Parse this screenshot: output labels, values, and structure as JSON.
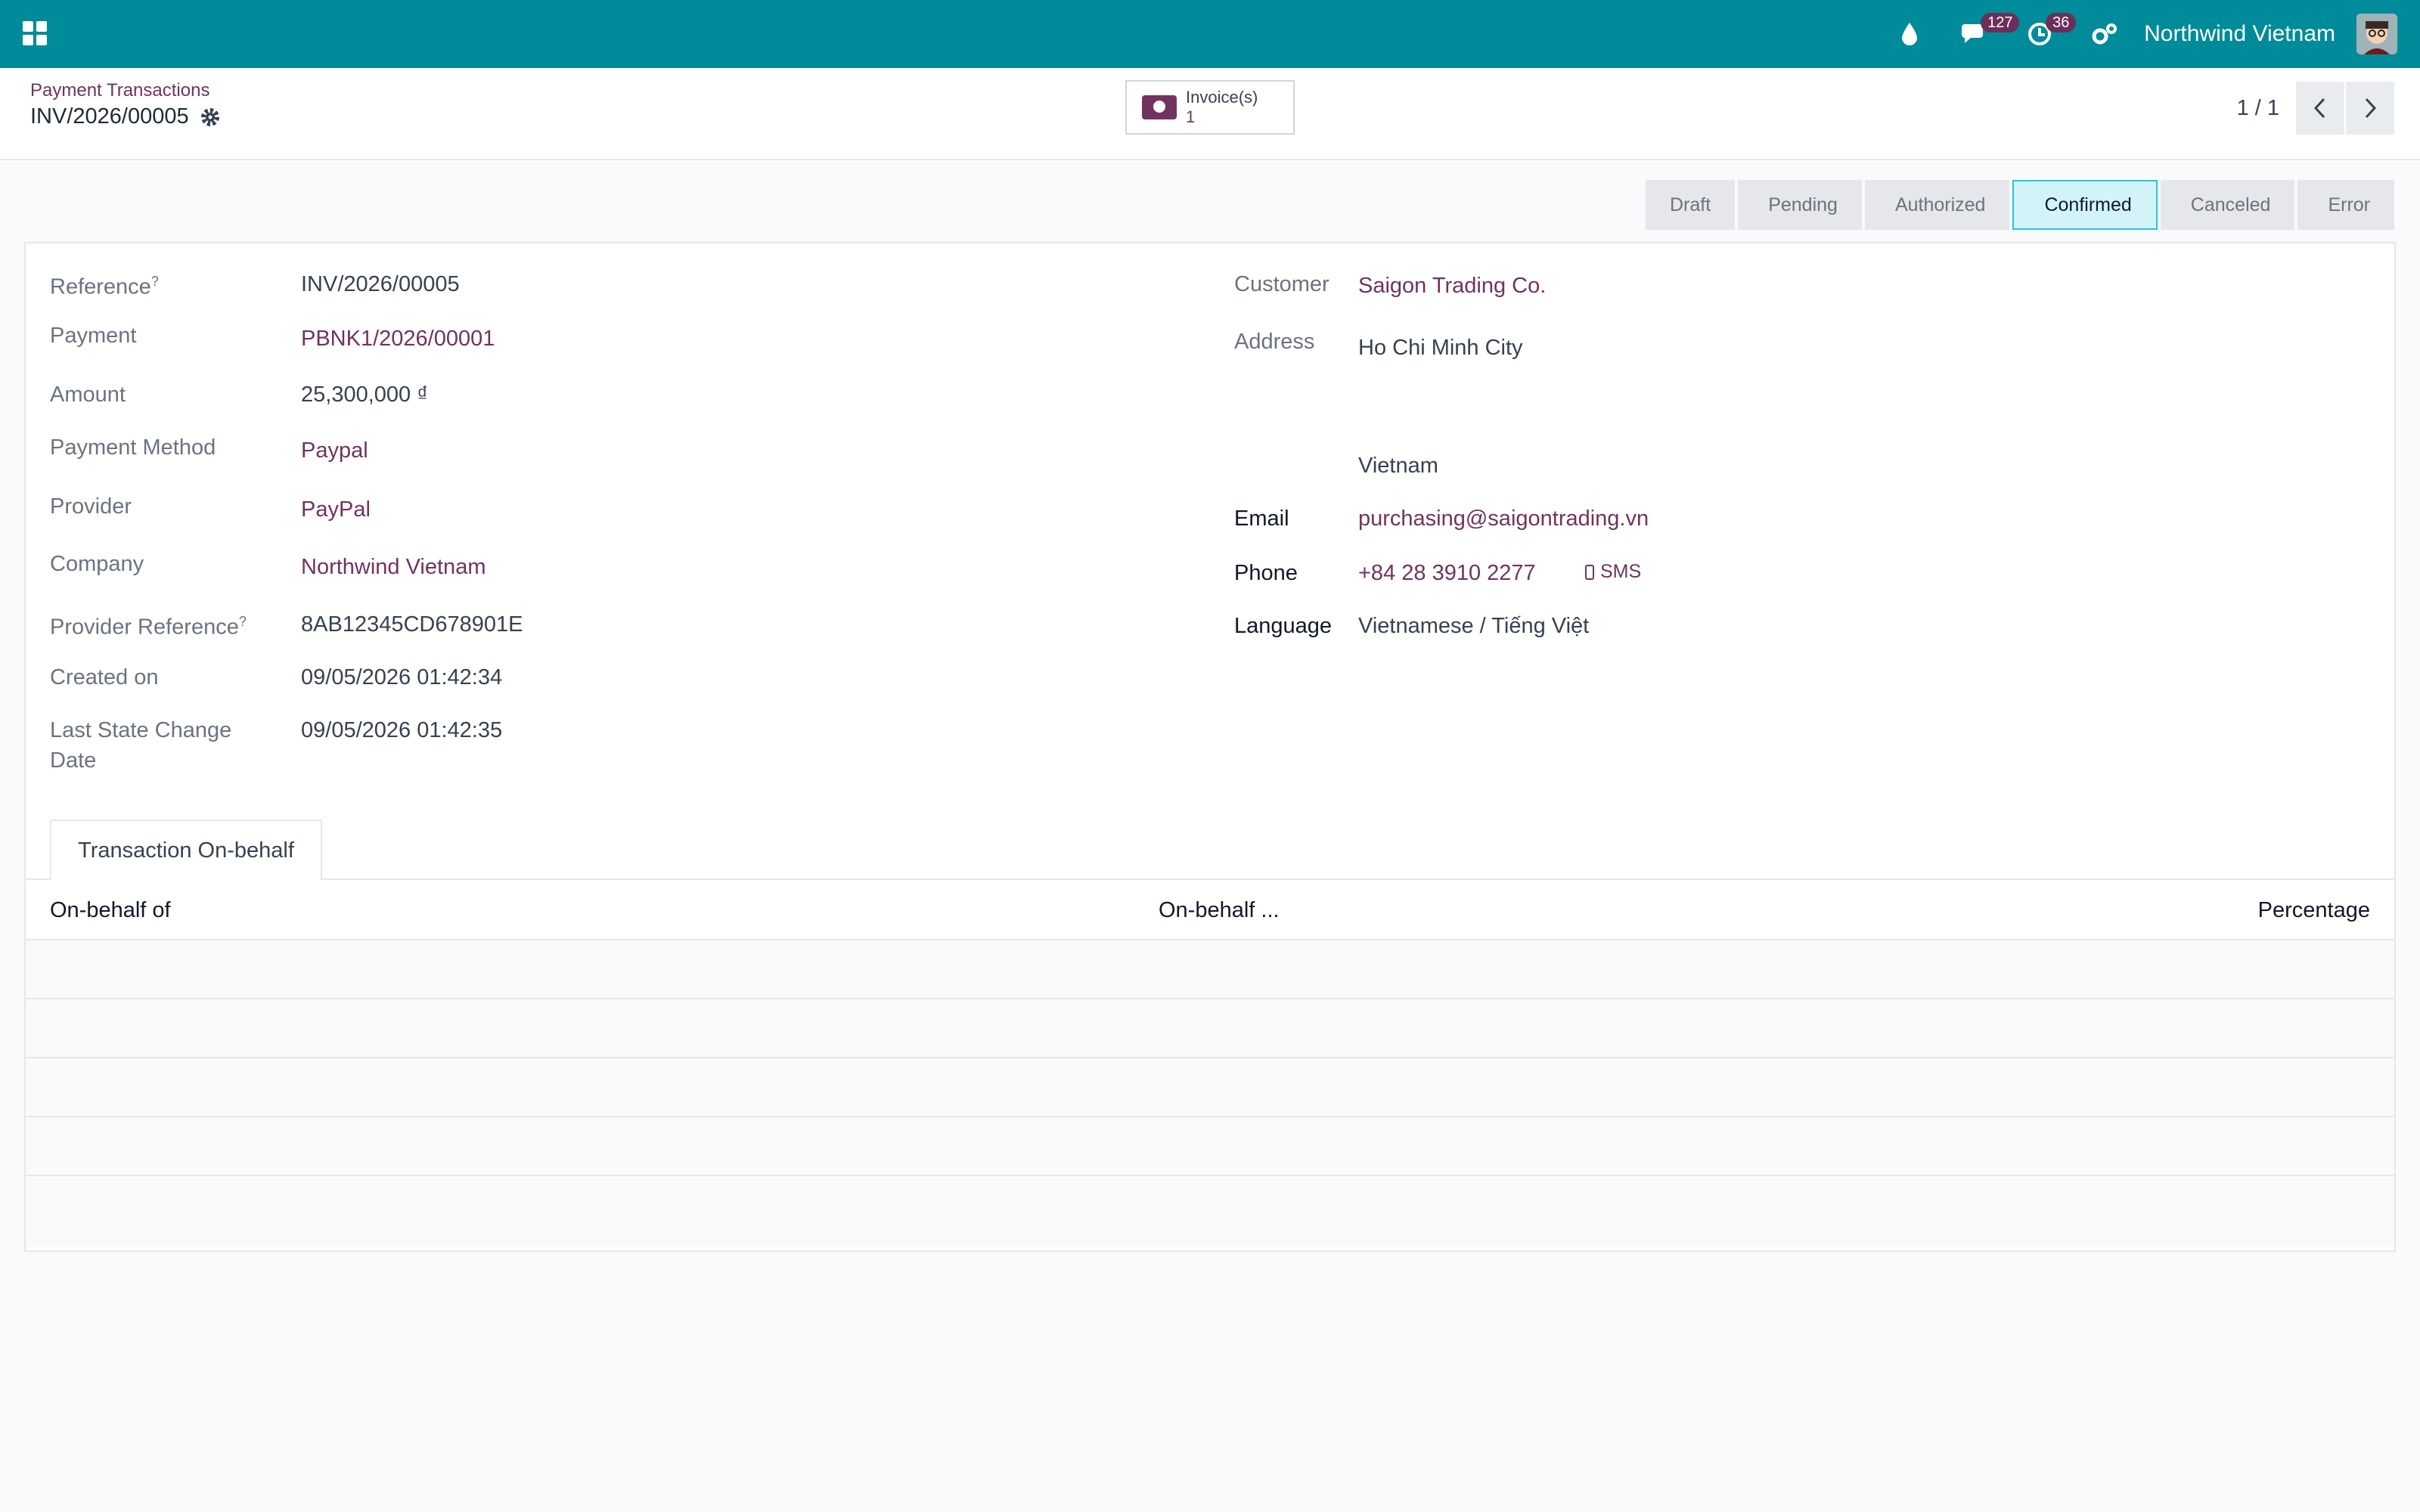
{
  "navbar": {
    "company": "Northwind Vietnam",
    "messages_count": "127",
    "activities_count": "36",
    "icons": [
      "apps-icon",
      "drop-icon",
      "chat-icon",
      "clock-icon",
      "gears-icon",
      "avatar"
    ]
  },
  "breadcrumb": {
    "parent": "Payment Transactions",
    "current": "INV/2026/00005"
  },
  "smart_button": {
    "label": "Invoice(s)",
    "count": "1"
  },
  "pager": {
    "value": "1 / 1"
  },
  "statusbar": {
    "steps": [
      "Draft",
      "Pending",
      "Authorized",
      "Confirmed",
      "Canceled",
      "Error"
    ],
    "active": "Confirmed"
  },
  "form": {
    "left": {
      "reference_label": "Reference",
      "reference": "INV/2026/00005",
      "payment_label": "Payment",
      "payment": "PBNK1/2026/00001",
      "amount_label": "Amount",
      "amount": "25,300,000 ₫",
      "payment_method_label": "Payment Method",
      "payment_method": "Paypal",
      "provider_label": "Provider",
      "provider": "PayPal",
      "company_label": "Company",
      "company": "Northwind Vietnam",
      "provider_reference_label": "Provider Reference",
      "provider_reference": "8AB12345CD678901E",
      "created_on_label": "Created on",
      "created_on": "09/05/2026 01:42:34",
      "last_state_label_1": "Last State Change",
      "last_state_label_2": "Date",
      "last_state": "09/05/2026 01:42:35",
      "help_mark": "?"
    },
    "right": {
      "customer_label": "Customer",
      "customer": "Saigon Trading Co.",
      "address_label": "Address",
      "address_city": "Ho Chi Minh City",
      "address_country": "Vietnam",
      "email_label": "Email",
      "email": "purchasing@saigontrading.vn",
      "phone_label": "Phone",
      "phone": "+84 28 3910 2277",
      "sms_label": "SMS",
      "language_label": "Language",
      "language": "Vietnamese / Tiếng Việt"
    }
  },
  "notebook": {
    "tab": "Transaction On-behalf",
    "columns": [
      "On-behalf of",
      "On-behalf ...",
      "Percentage"
    ]
  },
  "colors": {
    "navbar": "#008b9a",
    "link": "#71335f",
    "active_step": "#d2f4f8"
  }
}
